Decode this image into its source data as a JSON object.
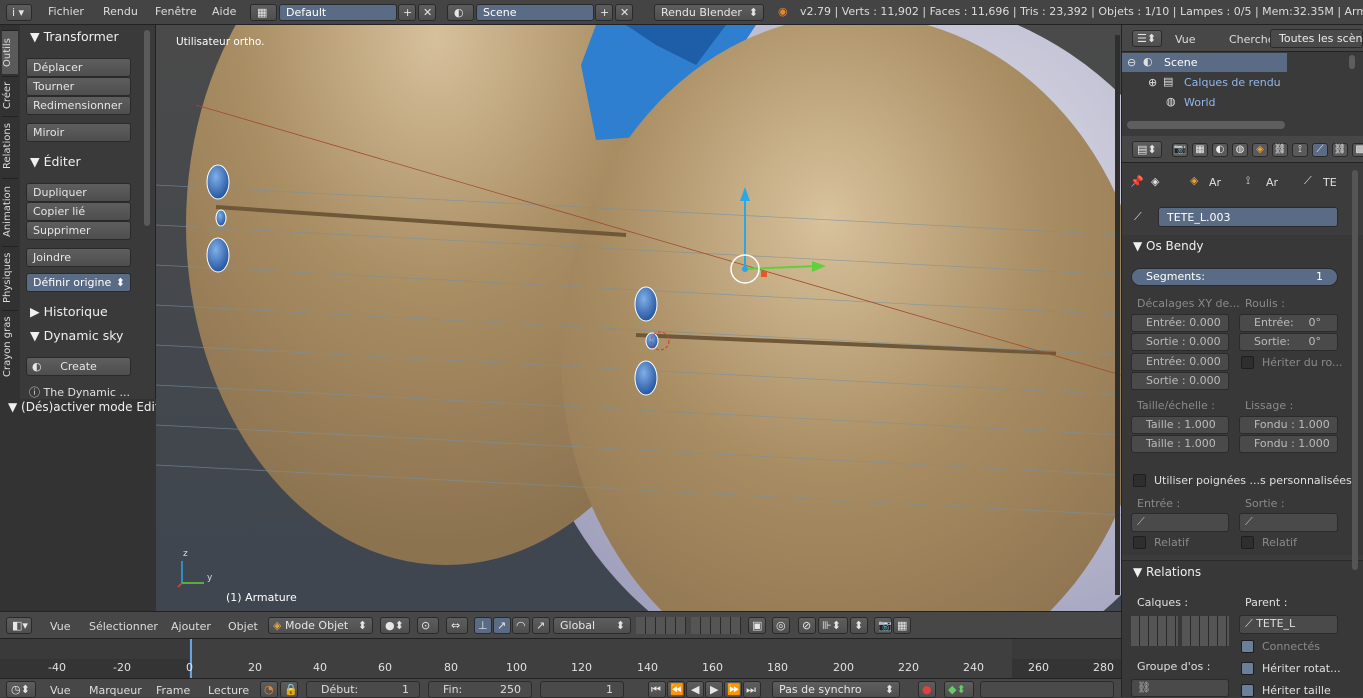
{
  "topbar": {
    "info_icon": "i",
    "menus": [
      "Fichier",
      "Rendu",
      "Fenêtre",
      "Aide"
    ],
    "layout": "Default",
    "scene": "Scene",
    "engine": "Rendu Blender",
    "stats": "v2.79 | Verts : 11,902 | Faces : 11,696 | Tris : 23,392 | Objets : 1/10 | Lampes : 0/5 | Mem:32.35M | Armat"
  },
  "toolshelf": {
    "tabs": [
      "Outils",
      "Créer",
      "Relations",
      "Animation",
      "Physiques",
      "Crayon gras"
    ],
    "transform_title": "Transformer",
    "transform_buttons": [
      "Déplacer",
      "Tourner",
      "Redimensionner"
    ],
    "mirror": "Miroir",
    "edit_title": "Éditer",
    "edit_buttons": [
      "Dupliquer",
      "Copier lié",
      "Supprimer"
    ],
    "join": "Joindre",
    "origin": "Définir origine",
    "history": "Historique",
    "sky": "Dynamic sky",
    "create": "Create",
    "sky_info": "The Dynamic ..."
  },
  "operator_title": "(Dés)activer mode Edit",
  "viewport": {
    "view_name": "Utilisateur ortho.",
    "object_label": "(1) Armature",
    "axis_z": "z",
    "axis_y": "y"
  },
  "viewport_header": {
    "menus": [
      "Vue",
      "Sélectionner",
      "Ajouter",
      "Objet"
    ],
    "mode": "Mode Objet",
    "orientation": "Global"
  },
  "timeline": {
    "ticks": [
      "-40",
      "-20",
      "0",
      "20",
      "40",
      "60",
      "80",
      "100",
      "120",
      "140",
      "160",
      "180",
      "200",
      "220",
      "240",
      "260",
      "280"
    ],
    "menus": [
      "Vue",
      "Marqueur",
      "Frame",
      "Lecture"
    ],
    "start_label": "Début:",
    "start": "1",
    "end_label": "Fin:",
    "end": "250",
    "current": "1",
    "sync": "Pas de synchro"
  },
  "outliner": {
    "menus": [
      "Vue",
      "Chercher"
    ],
    "filter": "Toutes les scène",
    "items": [
      "Scene",
      "Calques de rendu",
      "World"
    ]
  },
  "properties": {
    "context_short": [
      "Ar",
      "Ar",
      "TE"
    ],
    "bone_name": "TETE_L.003",
    "bendy_title": "Os Bendy",
    "segments_label": "Segments:",
    "segments": "1",
    "offsets_label": "Décalages XY de...",
    "roll_label": "Roulis :",
    "offsets": [
      "Entrée: 0.000",
      "Sortie : 0.000",
      "Entrée: 0.000",
      "Sortie : 0.000"
    ],
    "roll_in_label": "Entrée:",
    "roll_in": "0°",
    "roll_out_label": "Sortie:",
    "roll_out": "0°",
    "inherit_roll": "Hériter du ro...",
    "scale_label": "Taille/échelle :",
    "smooth_label": "Lissage :",
    "scale": [
      "Taille : 1.000",
      "Taille : 1.000"
    ],
    "ease": [
      "Fondu : 1.000",
      "Fondu : 1.000"
    ],
    "custom_handles": "Utiliser poignées ...s personnalisées",
    "in_label": "Entrée :",
    "out_label": "Sortie :",
    "relative": "Relatif",
    "relations_title": "Relations",
    "layers_label": "Calques :",
    "parent_label": "Parent :",
    "parent": "TETE_L",
    "connected": "Connectés",
    "bone_group_label": "Groupe d'os :",
    "inherit_rotation": "Hériter rotat...",
    "inherit_scale": "Hériter taille"
  }
}
